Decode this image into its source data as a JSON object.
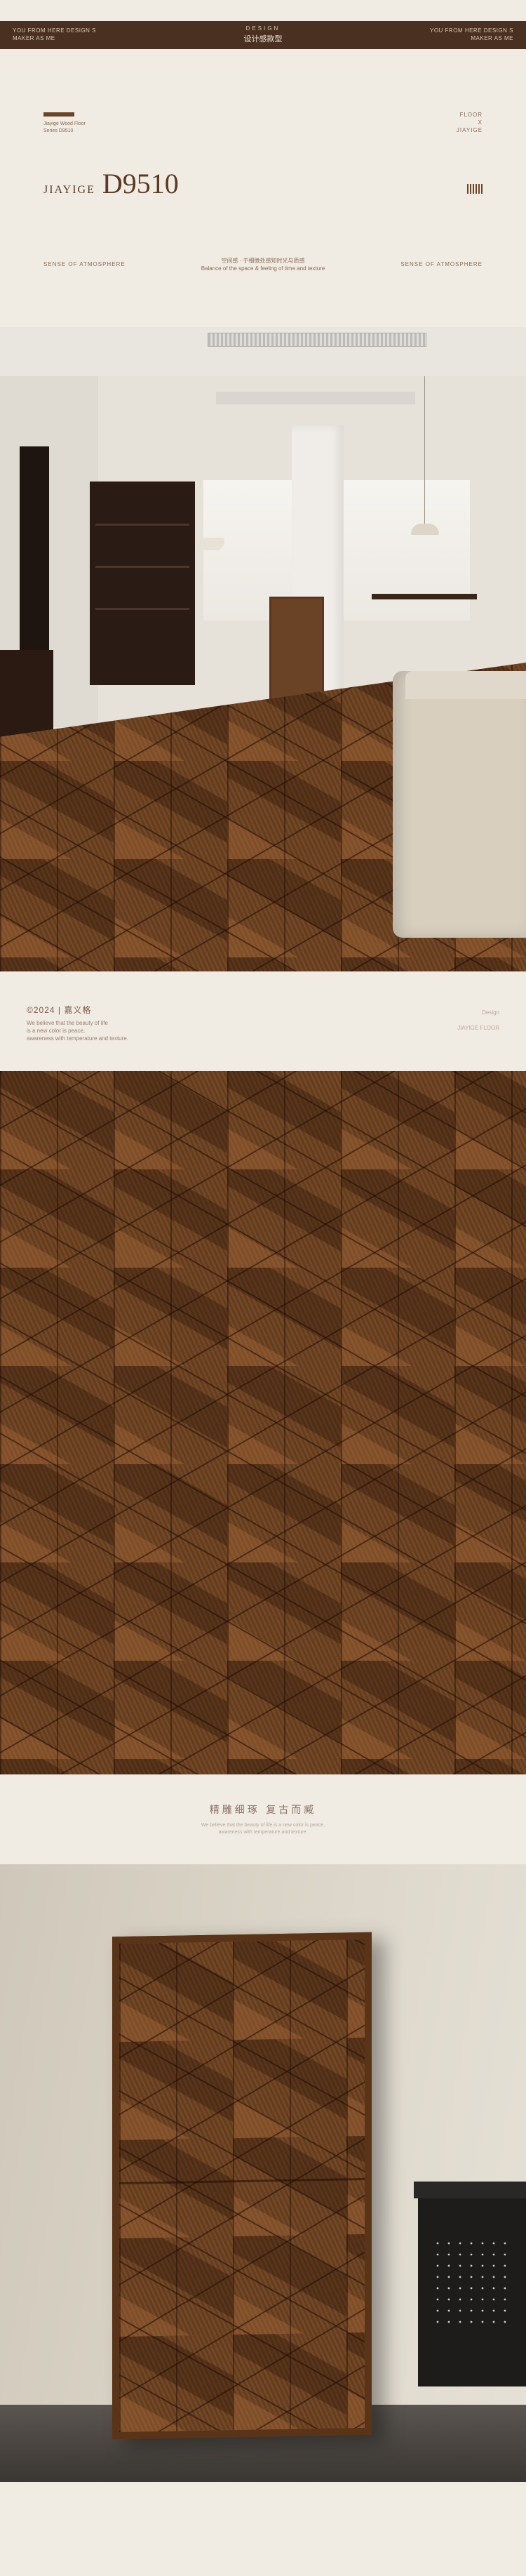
{
  "topbar": {
    "left_line1": "YOU FROM HERE DESIGN S",
    "left_line2": "MAKER AS ME",
    "center_small": "DESIGN",
    "center_main": "设计感款型",
    "right_line1": "YOU FROM HERE DESIGN S",
    "right_line2": "MAKER AS ME"
  },
  "header": {
    "meta_line1": "Jiayige Wood Floor",
    "meta_line2": "Series D9510",
    "right_line1": "FLOOR",
    "right_line2": "X",
    "right_line3": "JIAYIGE",
    "brand_prefix": "JIAYIGE",
    "model": "D9510",
    "sub_left": "SENSE OF ATMOSPHERE",
    "sub_center_line1": "空间感 · 于细微处感知时光与质感",
    "sub_center_line2": "Balance of the space & feeling of time and texture",
    "sub_right": "SENSE OF ATMOSPHERE"
  },
  "caption": {
    "year_label": "©2024 | 嘉义格",
    "desc_line1": "We believe that the beauty of life",
    "desc_line2": "is a new color is peace,",
    "desc_line3": "awareness with temperature and texture.",
    "right_line1": "Design",
    "right_line2": "JIAYIGE FLOOR"
  },
  "slogan": {
    "text": "精雕细琢  复古而臧",
    "sub_line1": "We believe that the beauty of life is a new color is peace,",
    "sub_line2": "awareness with temperature and texture."
  },
  "colors": {
    "background": "#f0ebe3",
    "topbar": "#4a3020",
    "wood": "#6b4020",
    "text": "#5a3a22"
  }
}
